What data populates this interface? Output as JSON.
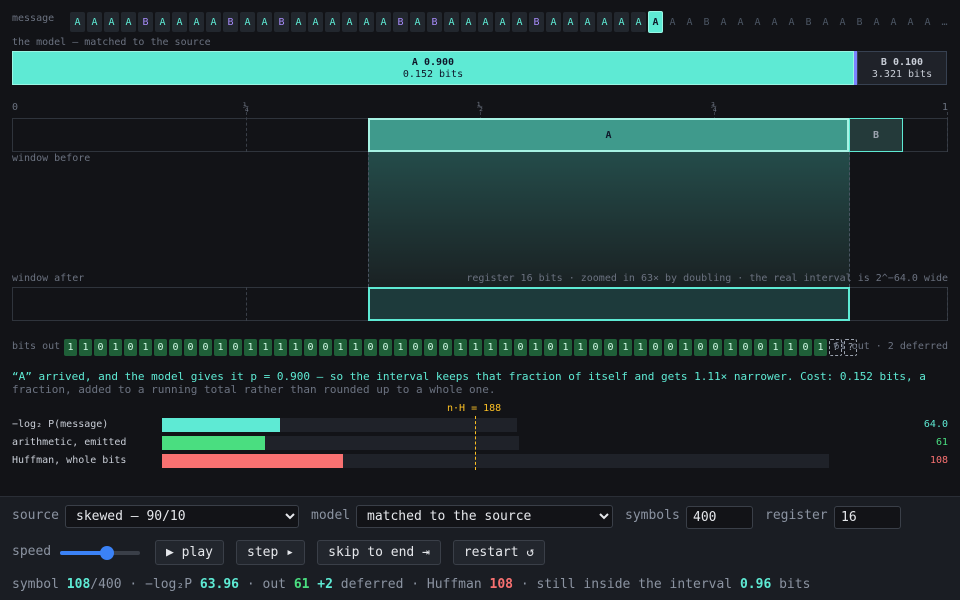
{
  "labels": {
    "message": "message",
    "model_caption": "the model — matched to the source",
    "window_before": "window before",
    "window_after": "window after",
    "register_note": "register 16 bits · zoomed in 63× by doubling · the real interval is 2^−64.0 wide",
    "bits_out": "bits out",
    "bits_summary": "61 out · 2 deferred",
    "nh_marker": "n·H = 188"
  },
  "message": {
    "encoded": [
      "A",
      "A",
      "A",
      "A",
      "B",
      "A",
      "A",
      "A",
      "A",
      "B",
      "A",
      "A",
      "B",
      "A",
      "A",
      "A",
      "A",
      "A",
      "A",
      "B",
      "A",
      "B",
      "A",
      "A",
      "A",
      "A",
      "A",
      "B",
      "A",
      "A",
      "A",
      "A",
      "A",
      "A"
    ],
    "current": "A",
    "upcoming": [
      "A",
      "A",
      "B",
      "A",
      "A",
      "A",
      "A",
      "A",
      "B",
      "A",
      "A",
      "B",
      "A",
      "A",
      "A",
      "A"
    ],
    "ellipsis": "…"
  },
  "model": {
    "a_label": "A  0.900",
    "a_bits": "0.152 bits",
    "b_label": "B  0.100",
    "b_bits": "3.321 bits",
    "p_a": 0.9
  },
  "axis_ticks": [
    "0",
    "¼",
    "½",
    "¾",
    "1"
  ],
  "window": {
    "a_label": "A",
    "b_label": "B"
  },
  "bits": [
    "1",
    "1",
    "0",
    "1",
    "0",
    "1",
    "0",
    "0",
    "0",
    "0",
    "1",
    "0",
    "1",
    "1",
    "1",
    "1",
    "0",
    "0",
    "1",
    "1",
    "0",
    "0",
    "1",
    "0",
    "0",
    "0",
    "1",
    "1",
    "1",
    "1",
    "0",
    "1",
    "0",
    "1",
    "1",
    "0",
    "0",
    "1",
    "1",
    "0",
    "0",
    "1",
    "0",
    "0",
    "1",
    "0",
    "0",
    "1",
    "1",
    "0",
    "1"
  ],
  "deferred_bits": [
    "?",
    "?"
  ],
  "caption": {
    "main": "“A” arrived, and the model gives it p = 0.900 — so the interval keeps that fraction of itself and gets 1.11× narrower. Cost: 0.152 bits, a",
    "rest": "fraction, added to a running total rather than rounded up to a whole one."
  },
  "comparison": [
    {
      "label": "−log₂ P(message)",
      "value": "64.0",
      "color": "#5eead4",
      "fill": 0.3322,
      "track": 355
    },
    {
      "label": "arithmetic, emitted",
      "value": "61",
      "color": "#4ade80",
      "fill": 0.2874,
      "track": 357
    },
    {
      "label": "Huffman, whole bits",
      "value": "108",
      "color": "#f87171",
      "fill": 0.2708,
      "track": 667
    }
  ],
  "controls": {
    "source_label": "source",
    "source_value": "skewed — 90/10",
    "model_label": "model",
    "model_value": "matched to the source",
    "symbols_label": "symbols",
    "symbols_value": "400",
    "register_label": "register",
    "register_value": "16",
    "speed_label": "speed",
    "speed_level": 0.6,
    "play": "▶ play",
    "step": "step ▸",
    "skip": "skip to end ⇥",
    "restart": "restart ↺"
  },
  "status": {
    "symbol_label": "symbol",
    "symbol_num": "108",
    "symbol_total": "/400",
    "neglog_label": "· −log₂P",
    "neglog_val": "63.96",
    "out_label": "· out",
    "out_val": "61",
    "deferred_val": "+2",
    "deferred_label": "deferred · Huffman",
    "huffman_val": "108",
    "inside_label": "· still inside the interval",
    "inside_val": "0.96",
    "bits_word": "bits"
  }
}
